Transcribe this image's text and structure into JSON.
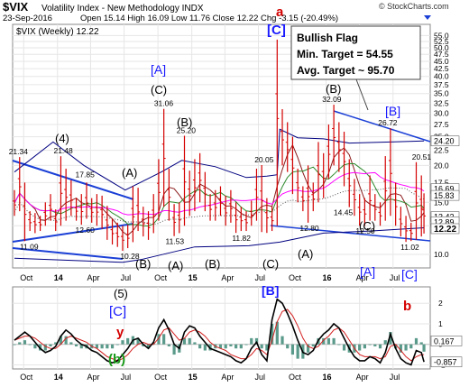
{
  "header": {
    "symbol": "$VIX",
    "name": "Volatility Index - New Methodology  INDX",
    "date": "23-Sep-2016",
    "quote": "Open 15.14  High 16.09  Low 11.76  Close 12.22  Chg -3.15 (-20.49%)",
    "watermark": "© StockCharts.com",
    "legend": "$VIX (Weekly) 12.22"
  },
  "annotation_box": {
    "title": "Bullish Flag",
    "min_target": "Min. Target = 54.55",
    "avg_target": "Avg. Target ~ 95.70"
  },
  "colors": {
    "price_bar": "#d40000",
    "upper_frame": "#000080",
    "trendline": "#1a3fd6",
    "ma_pink": "#ff00ff",
    "ma_green": "#2e8b2e",
    "ma_brown": "#8b1a1a",
    "wave_blue": "#1a1aff",
    "wave_red": "#d40000",
    "wave_green": "#1a9a1a",
    "hist": "#5a9a8a",
    "macd_line": "#000000",
    "signal_line": "#d42020"
  },
  "chart_data": [
    {
      "type": "bar",
      "title": "$VIX (Weekly) 12.22",
      "scale": "log",
      "ylim": [
        9,
        60
      ],
      "y_ticks": [
        10.0,
        12.5,
        15.0,
        17.5,
        20.0,
        22.5,
        25.0,
        27.5,
        30.0,
        32.5,
        35.0,
        37.5,
        40.0,
        42.5,
        45.0,
        47.5,
        50.0,
        52.5,
        55.0
      ],
      "y_tick_labels": [
        "10.0",
        "12.5",
        "15.0",
        "17.5",
        "20.0",
        "22.5",
        "25.0",
        "27.5",
        "30.0",
        "32.5",
        "35.0",
        "37.5",
        "40.0",
        "42.5",
        "45.0",
        "47.5",
        "50.0",
        "52.5",
        "55.0"
      ],
      "x_labels": [
        "Oct",
        "14",
        "Apr",
        "Jul",
        "Oct",
        "15",
        "Apr",
        "Jul",
        "Oct",
        "16",
        "Apr",
        "Jul"
      ],
      "last_value": 12.22,
      "axis_value_badges": [
        "24.20",
        "16.69",
        "15.83",
        "13.42",
        "12.89",
        "12.22"
      ],
      "peaks": [
        {
          "label": "21.34",
          "value": 21.34,
          "date": "2013-09"
        },
        {
          "label": "21.48",
          "value": 21.48,
          "date": "2014-01"
        },
        {
          "label": "17.85",
          "value": 17.85,
          "date": "2014-03"
        },
        {
          "label": "31.06",
          "value": 31.06,
          "date": "2014-10"
        },
        {
          "label": "25.20",
          "value": 25.2,
          "date": "2014-12"
        },
        {
          "label": "20.05",
          "value": 20.05,
          "date": "2015-07"
        },
        {
          "label": "32.09",
          "value": 32.09,
          "date": "2016-01"
        },
        {
          "label": "26.72",
          "value": 26.72,
          "date": "2016-06"
        },
        {
          "label": "20.51",
          "value": 20.51,
          "date": "2016-09"
        }
      ],
      "troughs": [
        {
          "label": "11.09",
          "value": 11.09,
          "date": "2013-10"
        },
        {
          "label": "12.60",
          "value": 12.6,
          "date": "2014-03"
        },
        {
          "label": "10.28",
          "value": 10.28,
          "date": "2014-07"
        },
        {
          "label": "11.53",
          "value": 11.53,
          "date": "2014-11"
        },
        {
          "label": "11.82",
          "value": 11.82,
          "date": "2015-05"
        },
        {
          "label": "12.80",
          "value": 12.8,
          "date": "2015-11"
        },
        {
          "label": "14.45",
          "value": 14.45,
          "date": "2016-02"
        },
        {
          "label": "12.50",
          "value": 12.5,
          "date": "2016-04"
        },
        {
          "label": "11.02",
          "value": 11.02,
          "date": "2016-08"
        }
      ],
      "series": [
        {
          "x": [
            "2013-09-06",
            "2013-09-20",
            "2013-10-04",
            "2013-10-18",
            "2013-11-01",
            "2013-11-15",
            "2013-11-29",
            "2013-12-13",
            "2013-12-27",
            "2014-01-10",
            "2014-01-24",
            "2014-02-07",
            "2014-02-21",
            "2014-03-07",
            "2014-03-21",
            "2014-04-04",
            "2014-04-18",
            "2014-05-02",
            "2014-05-16",
            "2014-05-30",
            "2014-06-13",
            "2014-06-27",
            "2014-07-11",
            "2014-07-25",
            "2014-08-08",
            "2014-08-22",
            "2014-09-05",
            "2014-09-19",
            "2014-10-03",
            "2014-10-17",
            "2014-10-31",
            "2014-11-14",
            "2014-11-28",
            "2014-12-12",
            "2014-12-26",
            "2015-01-09",
            "2015-01-23",
            "2015-02-06",
            "2015-02-20",
            "2015-03-06",
            "2015-03-20",
            "2015-04-03",
            "2015-04-17",
            "2015-05-01",
            "2015-05-15",
            "2015-05-29",
            "2015-06-12",
            "2015-06-26",
            "2015-07-10",
            "2015-07-24",
            "2015-08-07",
            "2015-08-21",
            "2015-09-04",
            "2015-09-18",
            "2015-10-02",
            "2015-10-16",
            "2015-10-30",
            "2015-11-13",
            "2015-11-27",
            "2015-12-11",
            "2015-12-25",
            "2016-01-08",
            "2016-01-22",
            "2016-02-05",
            "2016-02-19",
            "2016-03-04",
            "2016-03-18",
            "2016-04-01",
            "2016-04-15",
            "2016-04-29",
            "2016-05-13",
            "2016-05-27",
            "2016-06-10",
            "2016-06-24",
            "2016-07-08",
            "2016-07-22",
            "2016-08-05",
            "2016-08-19",
            "2016-09-02",
            "2016-09-16",
            "2016-09-23"
          ],
          "high": [
            16.5,
            21.34,
            17.5,
            14.0,
            13.8,
            13.5,
            15.0,
            16.0,
            14.2,
            21.48,
            19.5,
            17.85,
            15.5,
            16.0,
            17.5,
            15.5,
            16.0,
            15.8,
            14.6,
            13.2,
            12.8,
            12.5,
            12.6,
            17.0,
            16.8,
            14.5,
            14.0,
            16.0,
            21.0,
            31.06,
            19.5,
            14.8,
            15.0,
            25.2,
            19.2,
            21.0,
            22.0,
            19.0,
            16.0,
            16.5,
            17.0,
            15.8,
            16.5,
            15.0,
            14.5,
            14.0,
            15.2,
            19.5,
            20.05,
            15.5,
            14.5,
            53.3,
            31.0,
            28.0,
            25.0,
            19.5,
            17.0,
            20.0,
            17.5,
            24.0,
            22.0,
            27.5,
            32.09,
            28.0,
            26.0,
            21.0,
            18.0,
            16.0,
            15.5,
            18.5,
            16.0,
            15.0,
            21.5,
            26.72,
            17.5,
            14.5,
            13.5,
            12.8,
            20.51,
            18.5,
            16.09
          ],
          "low": [
            13.5,
            14.0,
            11.09,
            12.0,
            11.8,
            12.0,
            12.5,
            13.0,
            12.0,
            12.5,
            13.0,
            13.5,
            13.0,
            12.6,
            13.2,
            12.8,
            12.5,
            12.2,
            11.2,
            10.8,
            10.6,
            10.28,
            10.5,
            11.0,
            12.0,
            11.5,
            11.2,
            11.8,
            13.0,
            14.5,
            13.0,
            11.53,
            11.8,
            12.5,
            13.5,
            14.0,
            15.0,
            14.0,
            13.0,
            13.0,
            13.5,
            12.5,
            12.8,
            11.82,
            12.0,
            12.0,
            12.5,
            13.0,
            11.9,
            11.82,
            12.0,
            12.5,
            20.0,
            19.0,
            16.0,
            15.0,
            14.0,
            12.8,
            14.0,
            15.0,
            15.5,
            18.0,
            20.0,
            19.0,
            17.0,
            14.45,
            13.5,
            12.5,
            12.5,
            13.0,
            13.0,
            12.5,
            13.0,
            13.5,
            12.5,
            11.5,
            11.02,
            11.1,
            11.2,
            11.5,
            11.76
          ]
        }
      ]
    },
    {
      "type": "line",
      "title": "",
      "ylim": [
        -1.2,
        2.8
      ],
      "y_ticks": [
        -1,
        0,
        1,
        2
      ],
      "y_tick_labels": [
        "-1",
        "0",
        "1",
        "2"
      ],
      "axis_value_badges": [
        "0.167",
        "-0.857"
      ],
      "x_labels": [
        "Oct",
        "14",
        "Apr",
        "Jul",
        "Oct",
        "15",
        "Apr",
        "Jul",
        "Oct",
        "16",
        "Apr",
        "Jul"
      ],
      "series": [
        {
          "values": [
            0.2,
            0.4,
            0.6,
            0.4,
            0.1,
            -0.2,
            -0.4,
            -0.3,
            -0.1,
            0.4,
            0.7,
            0.5,
            0.2,
            0.0,
            -0.1,
            -0.3,
            -0.4,
            -0.6,
            -0.8,
            -0.9,
            -0.8,
            -0.5,
            -0.2,
            0.2,
            0.3,
            0.0,
            -0.2,
            0.1,
            0.8,
            1.2,
            0.7,
            0.0,
            -0.2,
            0.6,
            0.9,
            0.8,
            0.4,
            0.1,
            -0.2,
            -0.3,
            -0.4,
            -0.5,
            -0.6,
            -0.8,
            -0.9,
            -0.7,
            -0.2,
            0.1,
            -0.5,
            -0.8,
            1.2,
            2.2,
            2.0,
            1.5,
            0.9,
            0.2,
            -0.4,
            -0.5,
            -0.3,
            0.2,
            0.5,
            0.7,
            1.0,
            0.8,
            0.3,
            -0.2,
            -0.6,
            -0.8,
            -0.8,
            -0.6,
            -0.7,
            -0.9,
            -0.4,
            0.5,
            -0.2,
            -0.7,
            -0.9,
            -1.0,
            -0.3,
            -0.4,
            -0.857
          ]
        },
        {
          "values": [
            0.2,
            0.3,
            0.4,
            0.4,
            0.3,
            0.1,
            -0.1,
            -0.2,
            -0.2,
            0.0,
            0.3,
            0.4,
            0.3,
            0.2,
            0.1,
            -0.1,
            -0.2,
            -0.4,
            -0.6,
            -0.7,
            -0.8,
            -0.7,
            -0.5,
            -0.2,
            0.0,
            0.1,
            0.0,
            0.0,
            0.3,
            0.7,
            0.8,
            0.5,
            0.2,
            0.3,
            0.6,
            0.7,
            0.6,
            0.4,
            0.1,
            -0.1,
            -0.2,
            -0.3,
            -0.5,
            -0.6,
            -0.7,
            -0.7,
            -0.5,
            -0.2,
            -0.3,
            -0.5,
            0.2,
            1.1,
            1.6,
            1.7,
            1.4,
            0.9,
            0.3,
            -0.1,
            -0.2,
            -0.1,
            0.2,
            0.4,
            0.7,
            0.8,
            0.6,
            0.2,
            -0.2,
            -0.5,
            -0.6,
            -0.6,
            -0.6,
            -0.7,
            -0.6,
            -0.1,
            0.0,
            -0.3,
            -0.6,
            -0.8,
            -0.6,
            -0.5,
            -0.5
          ]
        }
      ],
      "histogram": [
        0.0,
        0.1,
        0.2,
        0.0,
        -0.2,
        -0.3,
        -0.3,
        -0.1,
        0.1,
        0.4,
        0.4,
        0.1,
        -0.1,
        -0.2,
        -0.2,
        -0.2,
        -0.2,
        -0.2,
        -0.2,
        -0.2,
        0.0,
        0.2,
        0.3,
        0.4,
        0.3,
        -0.1,
        -0.2,
        0.1,
        0.5,
        0.5,
        -0.1,
        -0.5,
        -0.4,
        0.3,
        0.3,
        0.1,
        -0.2,
        -0.3,
        -0.3,
        -0.2,
        -0.2,
        -0.2,
        -0.1,
        -0.2,
        -0.2,
        0.0,
        0.3,
        0.3,
        -0.2,
        -0.3,
        1.0,
        1.1,
        0.4,
        -0.2,
        -0.5,
        -0.7,
        -0.7,
        -0.4,
        -0.1,
        0.3,
        0.3,
        0.3,
        0.3,
        0.0,
        -0.3,
        -0.4,
        -0.4,
        -0.3,
        -0.2,
        0.0,
        -0.1,
        -0.2,
        0.2,
        0.6,
        -0.2,
        -0.4,
        -0.3,
        -0.2,
        0.3,
        0.1,
        -0.357
      ]
    }
  ],
  "wave_labels": {
    "a": "a",
    "C_top": "[C]",
    "A_mid": "[A]",
    "C_14": "(C)",
    "B_14": "(B)",
    "four": "(4)",
    "A_13": "(A)",
    "B_left": "(B)",
    "A_14b": "(A)",
    "B_15": "(B)",
    "C_15": "(C)",
    "A_15": "(A)",
    "B_16": "(B)",
    "C_16": "(C)",
    "B_bracket": "[B]",
    "A_bracket": "[A]",
    "C_bracket": "[C]",
    "five": "(5)",
    "C_lower": "[C]",
    "y": "y",
    "b_lower": "(b)",
    "B_lower": "[B]",
    "b_red": "b"
  }
}
